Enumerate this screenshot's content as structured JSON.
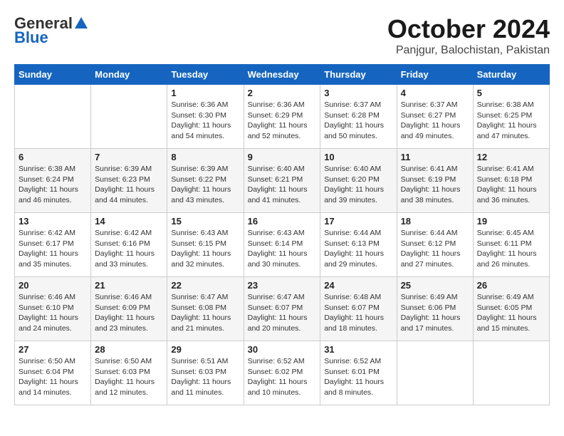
{
  "header": {
    "logo_general": "General",
    "logo_blue": "Blue",
    "month": "October 2024",
    "location": "Panjgur, Balochistan, Pakistan"
  },
  "days_of_week": [
    "Sunday",
    "Monday",
    "Tuesday",
    "Wednesday",
    "Thursday",
    "Friday",
    "Saturday"
  ],
  "weeks": [
    [
      {
        "day": "",
        "info": ""
      },
      {
        "day": "",
        "info": ""
      },
      {
        "day": "1",
        "info": "Sunrise: 6:36 AM\nSunset: 6:30 PM\nDaylight: 11 hours and 54 minutes."
      },
      {
        "day": "2",
        "info": "Sunrise: 6:36 AM\nSunset: 6:29 PM\nDaylight: 11 hours and 52 minutes."
      },
      {
        "day": "3",
        "info": "Sunrise: 6:37 AM\nSunset: 6:28 PM\nDaylight: 11 hours and 50 minutes."
      },
      {
        "day": "4",
        "info": "Sunrise: 6:37 AM\nSunset: 6:27 PM\nDaylight: 11 hours and 49 minutes."
      },
      {
        "day": "5",
        "info": "Sunrise: 6:38 AM\nSunset: 6:25 PM\nDaylight: 11 hours and 47 minutes."
      }
    ],
    [
      {
        "day": "6",
        "info": "Sunrise: 6:38 AM\nSunset: 6:24 PM\nDaylight: 11 hours and 46 minutes."
      },
      {
        "day": "7",
        "info": "Sunrise: 6:39 AM\nSunset: 6:23 PM\nDaylight: 11 hours and 44 minutes."
      },
      {
        "day": "8",
        "info": "Sunrise: 6:39 AM\nSunset: 6:22 PM\nDaylight: 11 hours and 43 minutes."
      },
      {
        "day": "9",
        "info": "Sunrise: 6:40 AM\nSunset: 6:21 PM\nDaylight: 11 hours and 41 minutes."
      },
      {
        "day": "10",
        "info": "Sunrise: 6:40 AM\nSunset: 6:20 PM\nDaylight: 11 hours and 39 minutes."
      },
      {
        "day": "11",
        "info": "Sunrise: 6:41 AM\nSunset: 6:19 PM\nDaylight: 11 hours and 38 minutes."
      },
      {
        "day": "12",
        "info": "Sunrise: 6:41 AM\nSunset: 6:18 PM\nDaylight: 11 hours and 36 minutes."
      }
    ],
    [
      {
        "day": "13",
        "info": "Sunrise: 6:42 AM\nSunset: 6:17 PM\nDaylight: 11 hours and 35 minutes."
      },
      {
        "day": "14",
        "info": "Sunrise: 6:42 AM\nSunset: 6:16 PM\nDaylight: 11 hours and 33 minutes."
      },
      {
        "day": "15",
        "info": "Sunrise: 6:43 AM\nSunset: 6:15 PM\nDaylight: 11 hours and 32 minutes."
      },
      {
        "day": "16",
        "info": "Sunrise: 6:43 AM\nSunset: 6:14 PM\nDaylight: 11 hours and 30 minutes."
      },
      {
        "day": "17",
        "info": "Sunrise: 6:44 AM\nSunset: 6:13 PM\nDaylight: 11 hours and 29 minutes."
      },
      {
        "day": "18",
        "info": "Sunrise: 6:44 AM\nSunset: 6:12 PM\nDaylight: 11 hours and 27 minutes."
      },
      {
        "day": "19",
        "info": "Sunrise: 6:45 AM\nSunset: 6:11 PM\nDaylight: 11 hours and 26 minutes."
      }
    ],
    [
      {
        "day": "20",
        "info": "Sunrise: 6:46 AM\nSunset: 6:10 PM\nDaylight: 11 hours and 24 minutes."
      },
      {
        "day": "21",
        "info": "Sunrise: 6:46 AM\nSunset: 6:09 PM\nDaylight: 11 hours and 23 minutes."
      },
      {
        "day": "22",
        "info": "Sunrise: 6:47 AM\nSunset: 6:08 PM\nDaylight: 11 hours and 21 minutes."
      },
      {
        "day": "23",
        "info": "Sunrise: 6:47 AM\nSunset: 6:07 PM\nDaylight: 11 hours and 20 minutes."
      },
      {
        "day": "24",
        "info": "Sunrise: 6:48 AM\nSunset: 6:07 PM\nDaylight: 11 hours and 18 minutes."
      },
      {
        "day": "25",
        "info": "Sunrise: 6:49 AM\nSunset: 6:06 PM\nDaylight: 11 hours and 17 minutes."
      },
      {
        "day": "26",
        "info": "Sunrise: 6:49 AM\nSunset: 6:05 PM\nDaylight: 11 hours and 15 minutes."
      }
    ],
    [
      {
        "day": "27",
        "info": "Sunrise: 6:50 AM\nSunset: 6:04 PM\nDaylight: 11 hours and 14 minutes."
      },
      {
        "day": "28",
        "info": "Sunrise: 6:50 AM\nSunset: 6:03 PM\nDaylight: 11 hours and 12 minutes."
      },
      {
        "day": "29",
        "info": "Sunrise: 6:51 AM\nSunset: 6:03 PM\nDaylight: 11 hours and 11 minutes."
      },
      {
        "day": "30",
        "info": "Sunrise: 6:52 AM\nSunset: 6:02 PM\nDaylight: 11 hours and 10 minutes."
      },
      {
        "day": "31",
        "info": "Sunrise: 6:52 AM\nSunset: 6:01 PM\nDaylight: 11 hours and 8 minutes."
      },
      {
        "day": "",
        "info": ""
      },
      {
        "day": "",
        "info": ""
      }
    ]
  ]
}
